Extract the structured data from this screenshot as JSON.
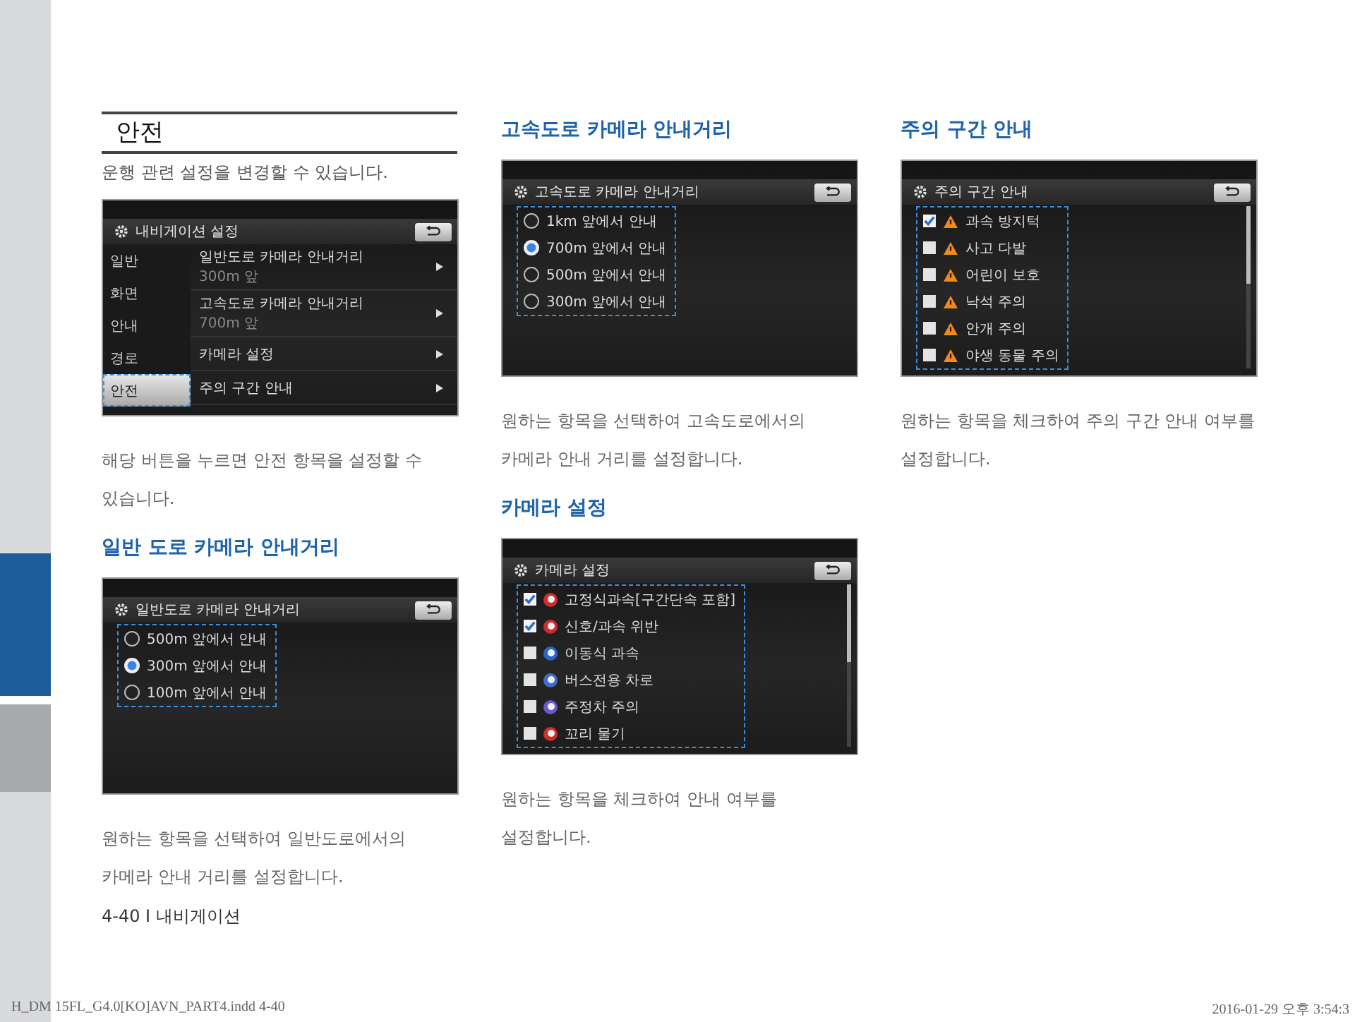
{
  "columns": [
    [
      {
        "heading": "안전",
        "kind": "chapter",
        "intro": "운행 관련 설정을 변경할 수 있습니다.",
        "screen": {
          "kind": "menu",
          "title": "내비게이션 설정",
          "sidebar": [
            {
              "label": "일반",
              "selected": false
            },
            {
              "label": "화면",
              "selected": false
            },
            {
              "label": "안내",
              "selected": false
            },
            {
              "label": "경로",
              "selected": false
            },
            {
              "label": "안전",
              "selected": true
            }
          ],
          "items": [
            {
              "title": "일반도로 카메라 안내거리",
              "subtitle": "300m 앞"
            },
            {
              "title": "고속도로 카메라 안내거리",
              "subtitle": "700m 앞"
            },
            {
              "title": "카메라 설정"
            },
            {
              "title": "주의 구간 안내"
            }
          ]
        },
        "text": "해당 버튼을 누르면 안전 항목을 설정할 수 있습니다."
      },
      {
        "heading": "일반 도로 카메라 안내거리",
        "kind": "sub",
        "screen": {
          "kind": "radio",
          "title": "일반도로 카메라 안내거리",
          "options": [
            {
              "label": "500m 앞에서 안내",
              "selected": false
            },
            {
              "label": "300m 앞에서 안내",
              "selected": true
            },
            {
              "label": "100m 앞에서 안내",
              "selected": false
            }
          ]
        },
        "text": "원하는 항목을 선택하여 일반도로에서의 카메라 안내 거리를 설정합니다."
      }
    ],
    [
      {
        "heading": "고속도로 카메라 안내거리",
        "kind": "sub",
        "screen": {
          "kind": "radio",
          "title": "고속도로 카메라 안내거리",
          "options": [
            {
              "label": "1km 앞에서 안내",
              "selected": false
            },
            {
              "label": "700m 앞에서 안내",
              "selected": true
            },
            {
              "label": "500m 앞에서 안내",
              "selected": false
            },
            {
              "label": "300m 앞에서 안내",
              "selected": false
            }
          ]
        },
        "text": "원하는 항목을 선택하여 고속도로에서의 카메라 안내 거리를 설정합니다."
      },
      {
        "heading": "카메라 설정",
        "kind": "sub",
        "screen": {
          "kind": "checklist",
          "title": "카메라 설정",
          "options": [
            {
              "label": "고정식과속[구간단속 포함]",
              "checked": true,
              "kind": "sign",
              "color": "#d42a2a"
            },
            {
              "label": "신호/과속 위반",
              "checked": true,
              "kind": "sign",
              "color": "#d42a2a"
            },
            {
              "label": "이동식 과속",
              "checked": false,
              "kind": "sign",
              "color": "#2a66c8"
            },
            {
              "label": "버스전용 차로",
              "checked": false,
              "kind": "sign",
              "color": "#3a6fd0"
            },
            {
              "label": "주정차 주의",
              "checked": false,
              "kind": "sign",
              "color": "#6a5ac8"
            },
            {
              "label": "꼬리 물기",
              "checked": false,
              "kind": "sign",
              "color": "#d42a2a"
            }
          ]
        },
        "text": "원하는 항목을 체크하여 안내 여부를 설정합니다."
      }
    ],
    [
      {
        "heading": "주의 구간 안내",
        "kind": "sub",
        "screen": {
          "kind": "checklist",
          "title": "주의 구간 안내",
          "options": [
            {
              "label": "과속 방지턱",
              "checked": true,
              "kind": "warning"
            },
            {
              "label": "사고 다발",
              "checked": false,
              "kind": "warning"
            },
            {
              "label": "어린이 보호",
              "checked": false,
              "kind": "warning"
            },
            {
              "label": "낙석 주의",
              "checked": false,
              "kind": "warning"
            },
            {
              "label": "안개 주의",
              "checked": false,
              "kind": "warning"
            },
            {
              "label": "야생 동물 주의",
              "checked": false,
              "kind": "warning"
            }
          ]
        },
        "text": "원하는 항목을 체크하여 주의 구간 안내 여부를 설정합니다."
      }
    ]
  ],
  "footer": "4-40 I 내비게이션",
  "slug": {
    "file": "H_DM 15FL_G4.0[KO]AVN_PART4.indd   4-40",
    "timestamp": "2016-01-29 오후 3:54:3"
  }
}
